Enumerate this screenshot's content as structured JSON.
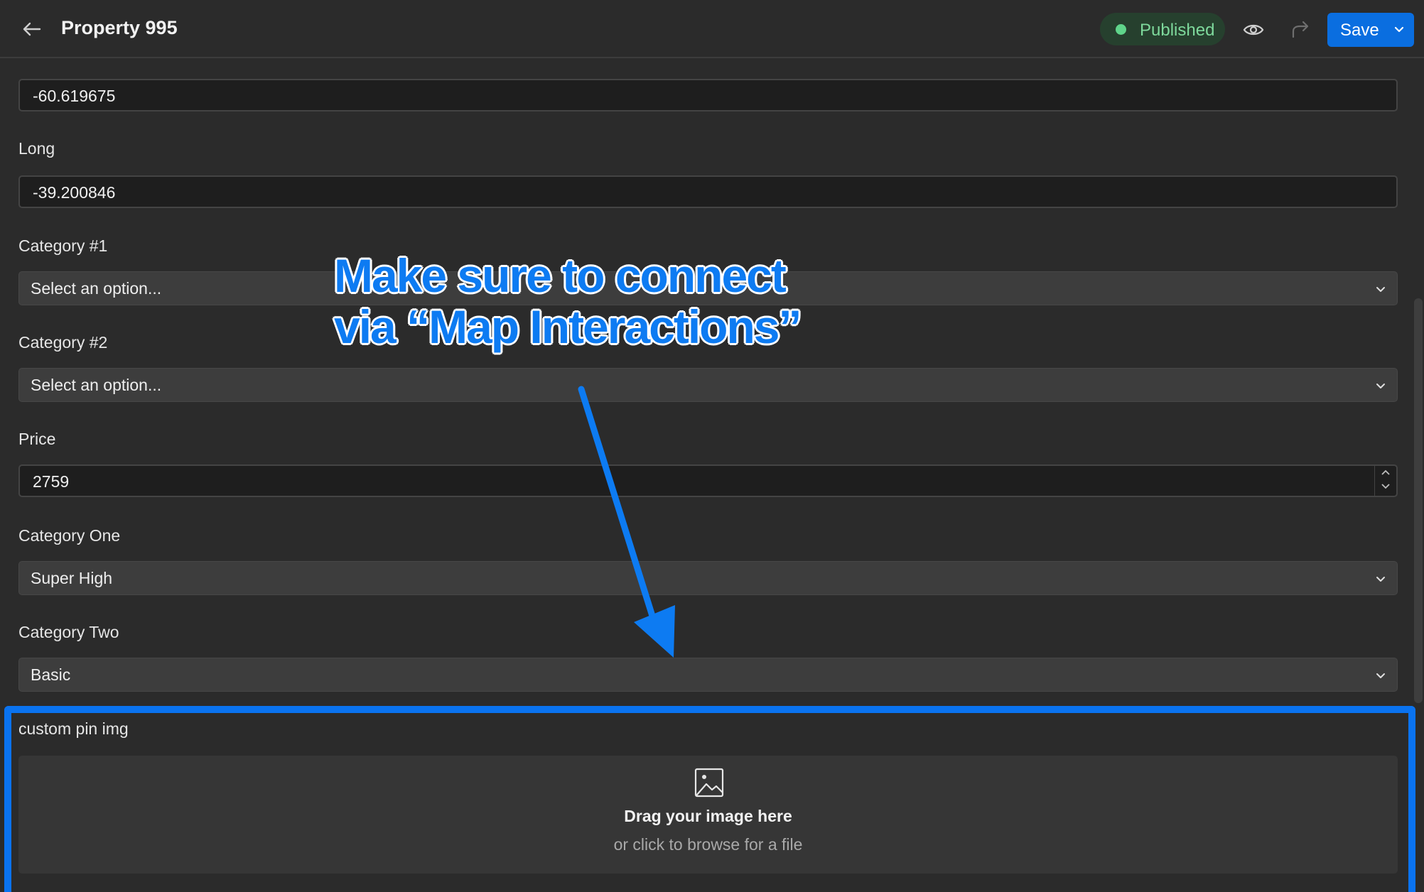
{
  "header": {
    "back_icon": "arrow-left-icon",
    "title": "Property 995",
    "status": "Published",
    "status_color": "#5fd48a",
    "preview_icon": "eye-icon",
    "share_icon": "share-arrow-icon",
    "save_label": "Save",
    "accent": "#0a6ee0"
  },
  "fields": {
    "lat": {
      "value": "-60.619675"
    },
    "long": {
      "label": "Long",
      "value": "-39.200846"
    },
    "category1": {
      "label": "Category #1",
      "value": "Select an option..."
    },
    "category2": {
      "label": "Category #2",
      "value": "Select an option..."
    },
    "price": {
      "label": "Price",
      "value": "2759"
    },
    "category_one": {
      "label": "Category One",
      "value": "Super High"
    },
    "category_two": {
      "label": "Category Two",
      "value": "Basic"
    },
    "custom_pin": {
      "label": "custom pin img",
      "drop_title": "Drag your image here",
      "drop_sub": "or click to browse for a file",
      "icon": "image-icon"
    }
  },
  "annotation": {
    "line1": "Make sure to connect",
    "line2": "via “Map Interactions”",
    "color": "#0d7bf2"
  }
}
